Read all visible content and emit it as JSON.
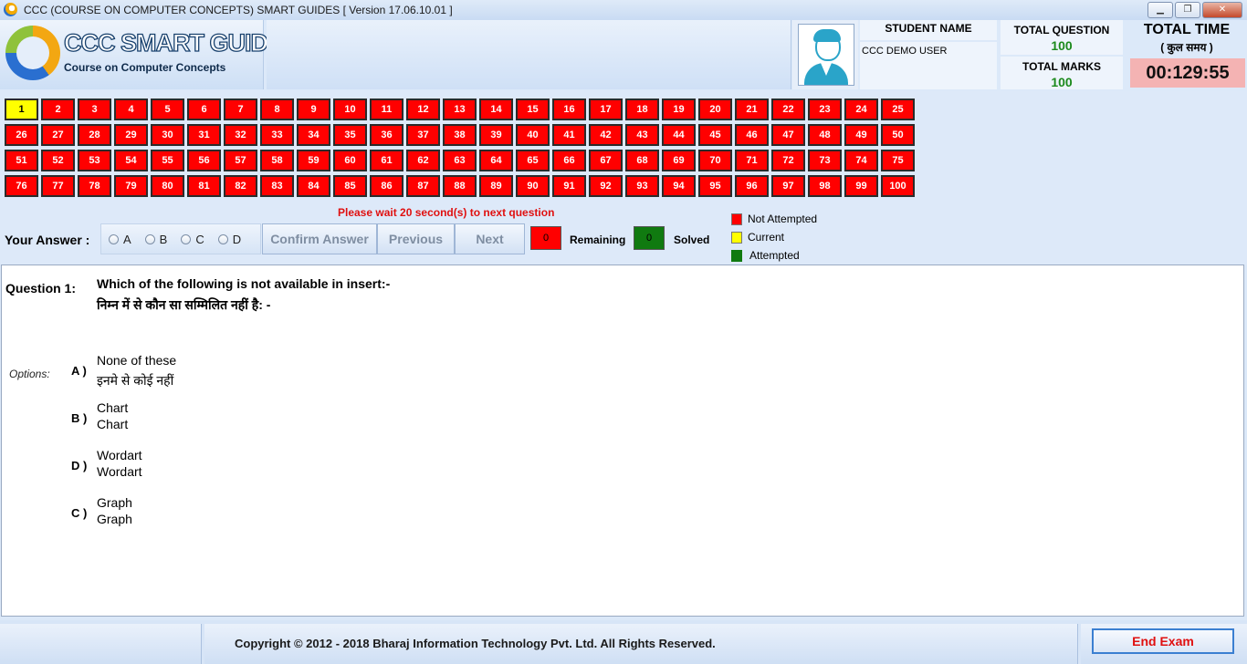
{
  "window": {
    "title": "CCC (COURSE ON COMPUTER CONCEPTS) SMART GUIDES [ Version 17.06.10.01 ]",
    "minimize_icon": "minimize-icon",
    "restore_icon": "restore-icon",
    "close_icon": "close-icon"
  },
  "logo": {
    "title": "CCC SMART GUIDE",
    "subtitle": "Course on Computer Concepts"
  },
  "student": {
    "name_label": "STUDENT NAME",
    "name_value": "CCC DEMO USER"
  },
  "stats": {
    "total_question_label": "TOTAL QUESTION",
    "total_question_value": "100",
    "total_marks_label": "TOTAL MARKS",
    "total_marks_value": "100",
    "total_time_label": "TOTAL TIME",
    "total_time_hindi": "( कुल समय )",
    "timer": "00:129:55"
  },
  "grid": {
    "count": 100,
    "current": 1,
    "colors": {
      "not_attempted": "#ff0000",
      "current": "#ffff00",
      "attempted": "#107a10"
    }
  },
  "answer": {
    "label": "Your Answer :",
    "options": [
      "A",
      "B",
      "C",
      "D"
    ],
    "confirm_label": "Confirm Answer",
    "previous_label": "Previous",
    "next_label": "Next",
    "wait_message": "Please wait 20 second(s) to next question",
    "remaining_value": "0",
    "remaining_label": "Remaining",
    "solved_value": "0",
    "solved_label": "Solved"
  },
  "legend": {
    "not_attempted": "Not Attempted",
    "current": "Current",
    "attempted": "Attempted"
  },
  "question": {
    "label": "Question 1:",
    "text_en": "Which of the following is not available in insert:-",
    "text_hi": "निम्न में से कौन सा सम्मिलित नहीं है: -",
    "options_label": "Options:",
    "options": [
      {
        "letter": "A )",
        "en": "None of these",
        "hi": "इनमे से कोई नहीं"
      },
      {
        "letter": "B )",
        "en": "Chart",
        "hi": "Chart"
      },
      {
        "letter": "D )",
        "en": "Wordart",
        "hi": "Wordart"
      },
      {
        "letter": "C )",
        "en": "Graph",
        "hi": "Graph"
      }
    ]
  },
  "footer": {
    "copyright": "Copyright © 2012 - 2018 Bharaj Information Technology Pvt. Ltd. All Rights Reserved.",
    "end_exam_label": "End Exam"
  }
}
